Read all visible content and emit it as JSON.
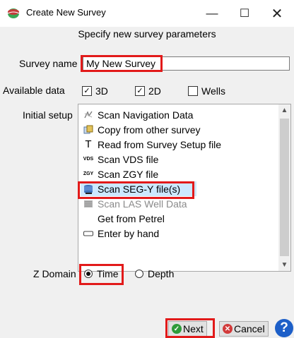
{
  "window": {
    "title": "Create New Survey",
    "controls": {
      "minimize": "—",
      "maximize": "☐",
      "close": "✕"
    }
  },
  "subtitle": "Specify new survey parameters",
  "survey_name": {
    "label": "Survey name",
    "value": "My New Survey"
  },
  "available_data": {
    "label": "Available data",
    "options": [
      {
        "label": "3D",
        "checked": true
      },
      {
        "label": "2D",
        "checked": true
      },
      {
        "label": "Wells",
        "checked": false
      }
    ]
  },
  "initial_setup": {
    "label": "Initial setup",
    "items": [
      {
        "label": "Scan Navigation Data",
        "icon": "navigation-icon",
        "enabled": true
      },
      {
        "label": "Copy from other survey",
        "icon": "copy-icon",
        "enabled": true
      },
      {
        "label": "Read from Survey Setup file",
        "icon": "text-icon",
        "glyph": "T",
        "enabled": true
      },
      {
        "label": "Scan VDS file",
        "icon": "vds-icon",
        "glyph": "VDS",
        "enabled": true
      },
      {
        "label": "Scan ZGY file",
        "icon": "zgy-icon",
        "glyph": "ZGY",
        "enabled": true
      },
      {
        "label": "Scan SEG-Y file(s)",
        "icon": "segy-icon",
        "enabled": true,
        "selected": true
      },
      {
        "label": "Scan LAS Well Data",
        "icon": "las-icon",
        "enabled": false
      },
      {
        "label": "Get from Petrel",
        "icon": "",
        "enabled": true
      },
      {
        "label": "Enter by hand",
        "icon": "keyboard-icon",
        "enabled": true
      }
    ]
  },
  "z_domain": {
    "label": "Z Domain",
    "options": [
      {
        "label": "Time",
        "selected": true
      },
      {
        "label": "Depth",
        "selected": false
      }
    ]
  },
  "buttons": {
    "next": "Next",
    "cancel": "Cancel",
    "help": "?"
  },
  "colors": {
    "highlight": "#e21a1a",
    "selection": "#cce8ff",
    "next_icon": "#2e9b3a",
    "cancel_icon": "#d23a3a",
    "help": "#1d5fc8"
  }
}
